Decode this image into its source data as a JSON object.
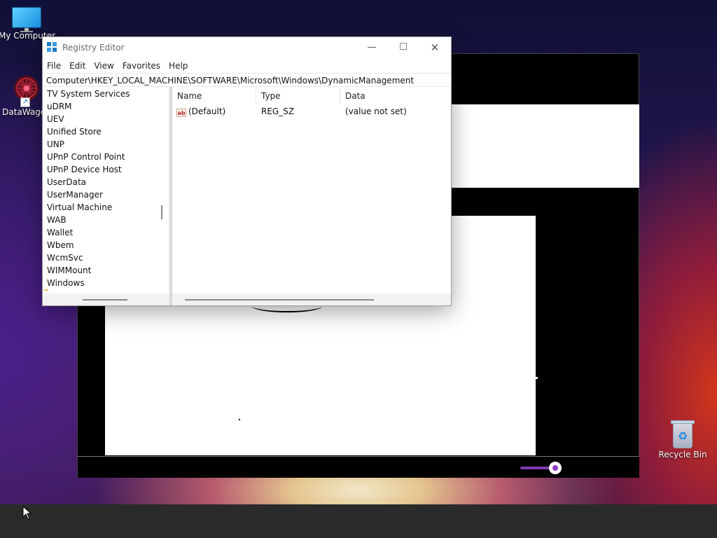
{
  "desktop": {
    "icons": [
      {
        "label": "My Computer"
      },
      {
        "label": "DataWagon"
      },
      {
        "label": "Recycle Bin"
      }
    ]
  },
  "registry_editor": {
    "title": "Registry Editor",
    "menu": [
      "File",
      "Edit",
      "View",
      "Favorites",
      "Help"
    ],
    "address": "Computer\\HKEY_LOCAL_MACHINE\\SOFTWARE\\Microsoft\\Windows\\DynamicManagement",
    "tree_items": [
      "TV System Services",
      "uDRM",
      "UEV",
      "Unified Store",
      "UNP",
      "UPnP Control Point",
      "UPnP Device Host",
      "UserData",
      "UserManager",
      "Virtual Machine",
      "WAB",
      "Wallet",
      "Wbem",
      "WcmSvc",
      "WIMMount",
      "Windows"
    ],
    "columns": [
      "Name",
      "Type",
      "Data"
    ],
    "rows": [
      {
        "name": "(Default)",
        "type": "REG_SZ",
        "data": "(value not set)"
      }
    ]
  },
  "media_window": {
    "slider_accent": "#8e3ec6"
  }
}
